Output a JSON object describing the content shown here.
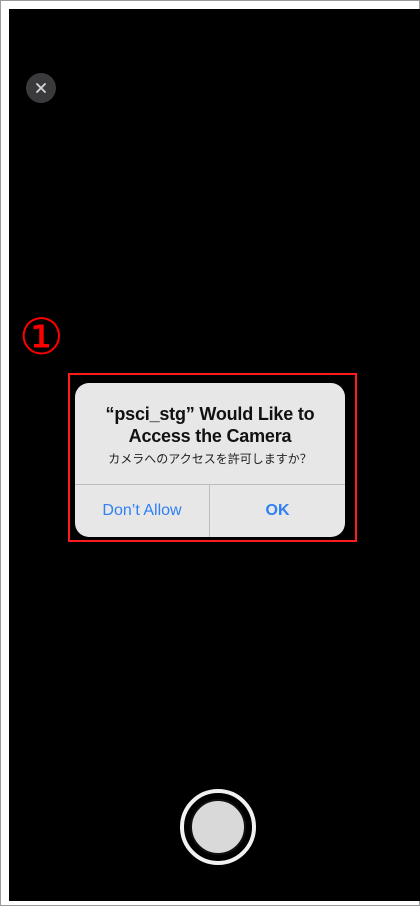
{
  "screen": {
    "background": "#000000",
    "close_icon": "close-icon"
  },
  "annotation": {
    "number": "①",
    "color": "#ff0000"
  },
  "alert": {
    "title": "“psci_stg” Would Like to\nAccess the Camera",
    "message": "カメラへのアクセスを許可しますか？",
    "buttons": [
      {
        "label": "Don’t Allow",
        "color": "#2f7ff6"
      },
      {
        "label": "OK",
        "color": "#2f7ff6"
      }
    ]
  },
  "camera": {
    "shutter_icon": "shutter-button"
  }
}
